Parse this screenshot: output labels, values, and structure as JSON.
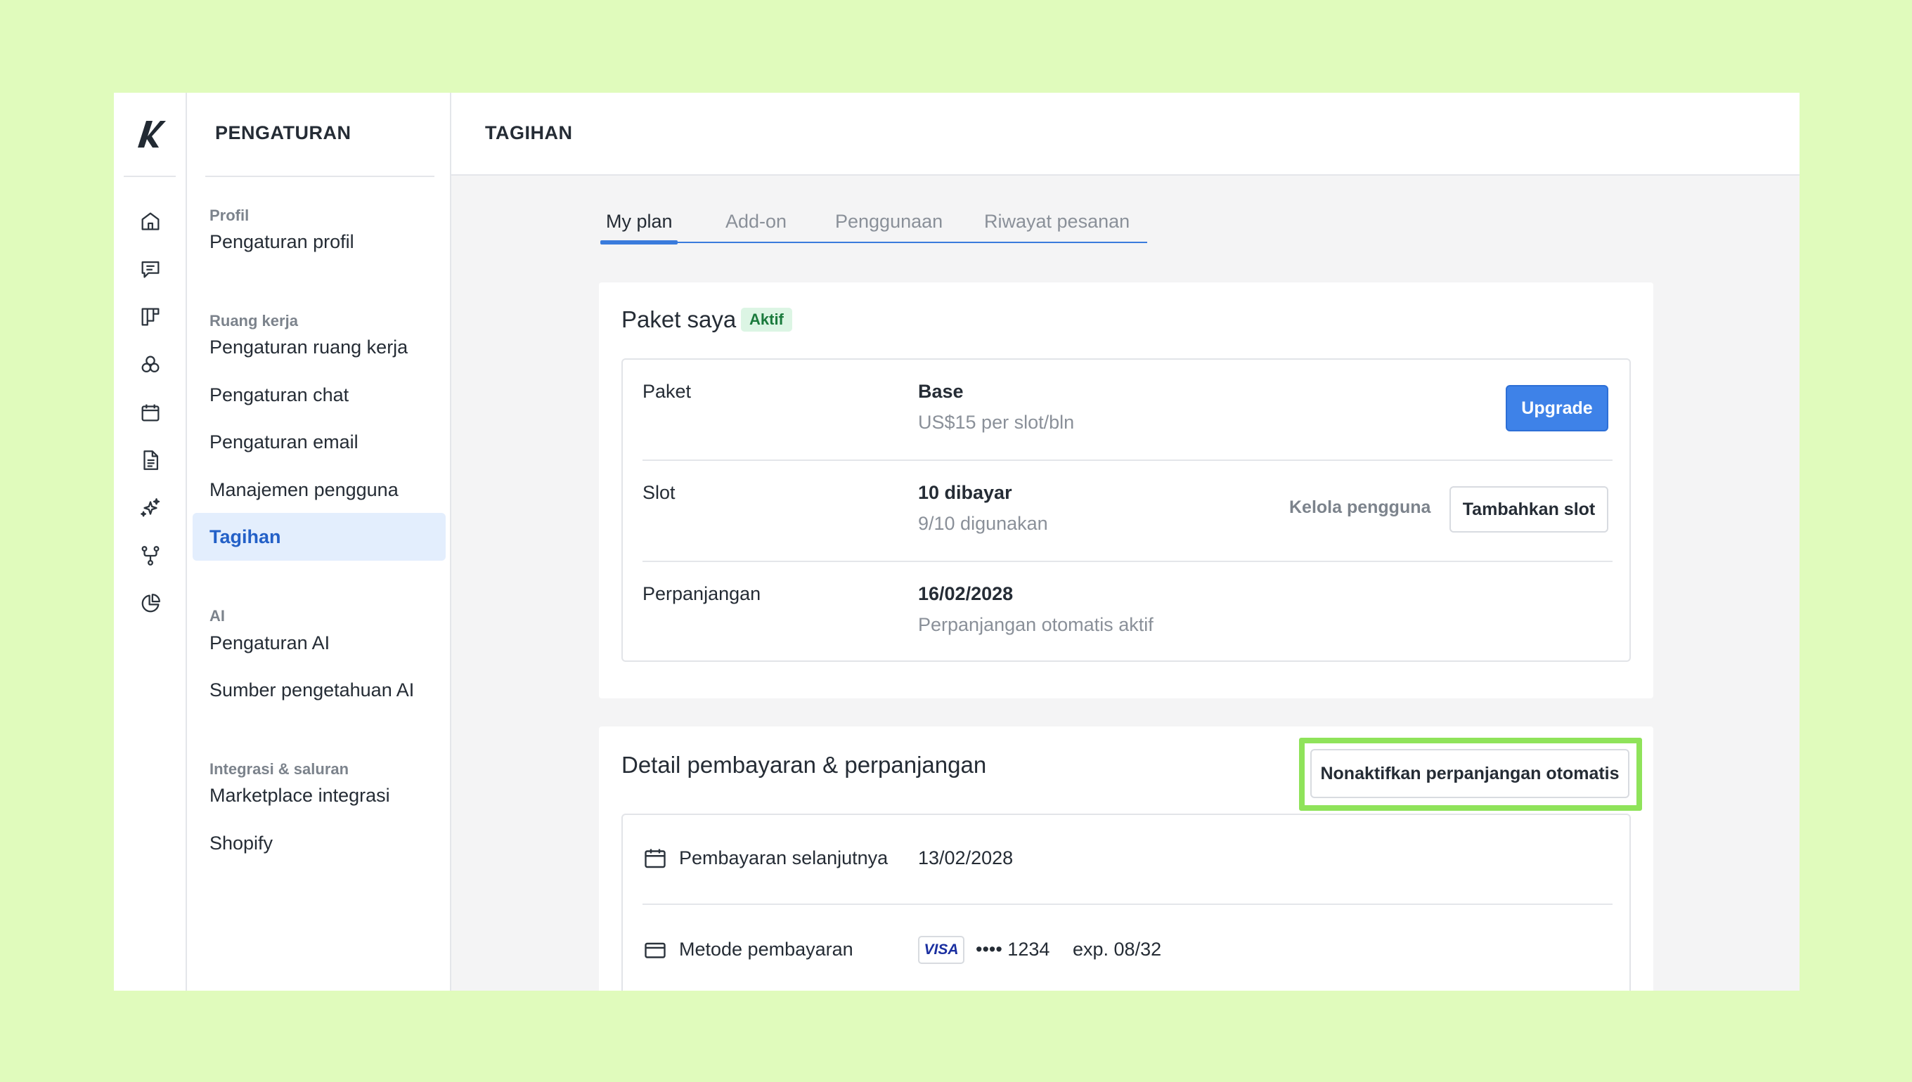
{
  "colors": {
    "page_background": "#e0fbbc",
    "accent": "#3e82e8",
    "active_nav_bg": "#e3eefd",
    "active_nav_text": "#2360c7",
    "badge_bg": "#dcf5e4",
    "badge_text": "#1a7a3c",
    "highlight_border": "#8fe35a"
  },
  "rail": {
    "logo": "k-logo",
    "icons": [
      "home-icon",
      "chat-icon",
      "board-icon",
      "contacts-icon",
      "calendar-icon",
      "document-icon",
      "sparkles-icon",
      "workflow-icon",
      "reports-icon"
    ]
  },
  "sidebar": {
    "title": "PENGATURAN",
    "sections": [
      {
        "label": "Profil",
        "items": [
          "Pengaturan profil"
        ]
      },
      {
        "label": "Ruang kerja",
        "items": [
          "Pengaturan ruang kerja",
          "Pengaturan chat",
          "Pengaturan email",
          "Manajemen pengguna",
          "Tagihan"
        ]
      },
      {
        "label": "AI",
        "items": [
          "Pengaturan AI",
          "Sumber pengetahuan AI"
        ]
      },
      {
        "label": "Integrasi & saluran",
        "items": [
          "Marketplace integrasi",
          "Shopify"
        ]
      }
    ],
    "active_item": "Tagihan"
  },
  "header": {
    "title": "TAGIHAN"
  },
  "tabs": [
    "My plan",
    "Add-on",
    "Penggunaan",
    "Riwayat pesanan"
  ],
  "active_tab": "My plan",
  "plan_card": {
    "title": "Paket saya",
    "badge": "Aktif",
    "rows": [
      {
        "label": "Paket",
        "value": "Base",
        "sub": "US$15 per slot/bln"
      },
      {
        "label": "Slot",
        "value": "10 dibayar",
        "sub": "9/10 digunakan"
      },
      {
        "label": "Perpanjangan",
        "value": "16/02/2028",
        "sub": "Perpanjangan otomatis aktif"
      }
    ],
    "upgrade_button": "Upgrade",
    "manage_users_link": "Kelola pengguna",
    "add_slot_button": "Tambahkan slot"
  },
  "payment_card": {
    "title": "Detail pembayaran & perpanjangan",
    "disable_autorenew_button": "Nonaktifkan perpanjangan otomatis",
    "next_payment_label": "Pembayaran selanjutnya",
    "next_payment_value": "13/02/2028",
    "payment_method_label": "Metode pembayaran",
    "card_brand": "VISA",
    "card_number": "•••• 1234",
    "card_expiry": "exp. 08/32"
  }
}
